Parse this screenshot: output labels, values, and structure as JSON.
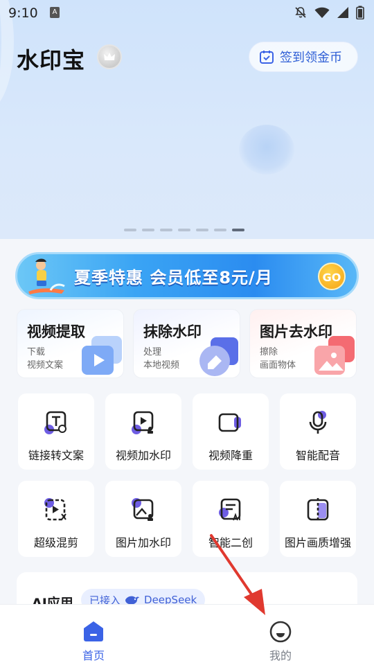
{
  "status_bar": {
    "time": "9:10",
    "badge": "A"
  },
  "header": {
    "app_name": "水印宝",
    "checkin_label": "签到领金币"
  },
  "carousel": {
    "total": 7,
    "active": 7
  },
  "promo": {
    "text": "夏季特惠  会员低至8元/月",
    "go_label": "GO"
  },
  "features": [
    {
      "title": "视频提取",
      "sub1": "下载",
      "sub2": "视频文案",
      "accent": "#5b8df5"
    },
    {
      "title": "抹除水印",
      "sub1": "处理",
      "sub2": "本地视频",
      "accent": "#4d61e6"
    },
    {
      "title": "图片去水印",
      "sub1": "擦除",
      "sub2": "画面物体",
      "accent": "#f2676e"
    }
  ],
  "tools": [
    {
      "label": "链接转文案",
      "icon": "link-text-icon"
    },
    {
      "label": "视频加水印",
      "icon": "video-watermark-icon"
    },
    {
      "label": "视频降重",
      "icon": "video-dedupe-icon"
    },
    {
      "label": "智能配音",
      "icon": "microphone-icon"
    },
    {
      "label": "超级混剪",
      "icon": "video-mix-icon"
    },
    {
      "label": "图片加水印",
      "icon": "image-watermark-icon"
    },
    {
      "label": "智能二创",
      "icon": "ai-create-icon"
    },
    {
      "label": "图片画质增强",
      "icon": "image-enhance-icon"
    }
  ],
  "ai_section": {
    "title": "AI应用",
    "pill_prefix": "已接入",
    "pill_brand": "DeepSeek"
  },
  "bottom_nav": {
    "home_label": "首页",
    "mine_label": "我的"
  },
  "colors": {
    "accent": "#3b63e6",
    "icon_accent": "#6e5de3",
    "arrow": "#e0392f"
  }
}
